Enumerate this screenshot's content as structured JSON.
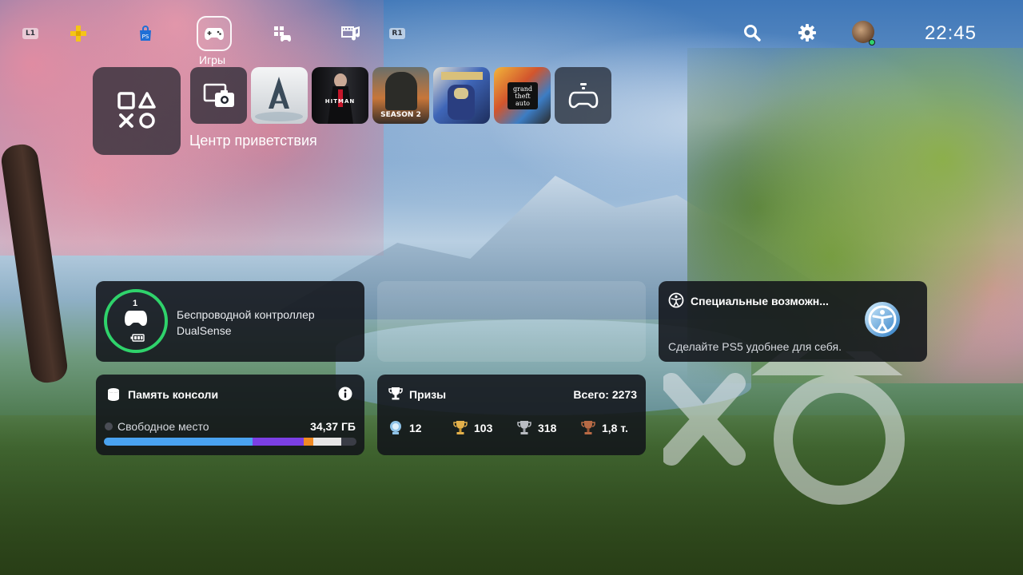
{
  "topbar": {
    "l1_label": "L1",
    "r1_label": "R1",
    "games_label": "Игры",
    "time": "22:45",
    "icons": [
      "ps-plus-icon",
      "ps-store-icon",
      "games-icon",
      "apps-icon",
      "media-icon",
      "search-icon",
      "settings-icon",
      "avatar"
    ]
  },
  "games_row": {
    "hub_icon": "ps-symbols-icon",
    "welcome_label": "Центр приветствия",
    "tiles": [
      {
        "name": "capture-gallery-icon"
      },
      {
        "name": "assassins-creed"
      },
      {
        "name": "hitman",
        "cover_text": "HITMAN"
      },
      {
        "name": "battlefield",
        "cover_text": "SEASON 2"
      },
      {
        "name": "helldivers"
      },
      {
        "name": "gta-v",
        "cover_text": "grand theft auto"
      },
      {
        "name": "game-library-icon"
      }
    ]
  },
  "controller_card": {
    "player_number": "1",
    "line1": "Беспроводной контроллер",
    "line2": "DualSense"
  },
  "accessibility_card": {
    "title": "Специальные возможн...",
    "subtitle": "Сделайте PS5 удобнее для себя."
  },
  "storage_card": {
    "title": "Память консоли",
    "free_label": "Свободное место",
    "free_value": "34,37 ГБ"
  },
  "trophies_card": {
    "title": "Призы",
    "total": "Всего: 2273",
    "platinum": "12",
    "gold": "103",
    "silver": "318",
    "bronze": "1,8 т."
  },
  "colors": {
    "accent_green": "#2fd36b",
    "card_bg": "#12141a",
    "bar_blue": "#4aa3f0",
    "bar_purple": "#7b3fe4",
    "bar_orange": "#f08a24",
    "bar_white": "#e6e6e6"
  }
}
